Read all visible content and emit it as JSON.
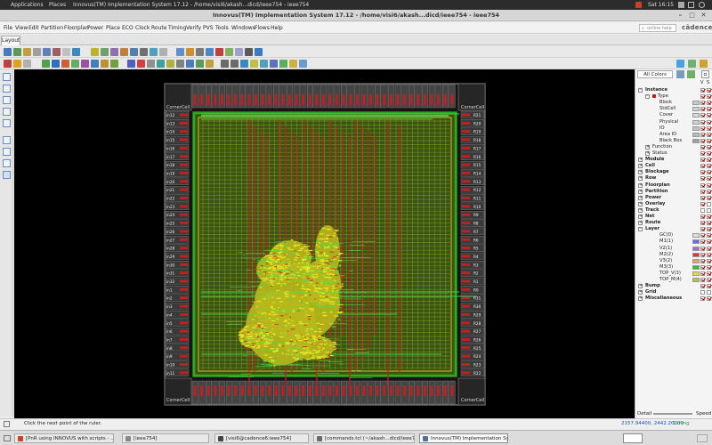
{
  "system_bar": {
    "applications": "Applications",
    "places": "Places",
    "window_title": "Innovus(TM) Implementation System 17.12 - /home/visi6/akash...dicd/ieee754 - ieee754",
    "clock": "Sat 16:15"
  },
  "title_bar": {
    "title": "Innovus(TM) Implementation System 17.12 - /home/visi6/akash...dicd/ieee754 - ieee754"
  },
  "menu": {
    "items": [
      "File",
      "View",
      "Edit",
      "Partition",
      "Floorplan",
      "Power",
      "Place",
      "ECO",
      "Clock",
      "Route",
      "Timing",
      "Verify",
      "PVS",
      "Tools",
      "Windows",
      "Flows",
      "Help"
    ],
    "search_placeholder": "online help",
    "brand": "cādence"
  },
  "tabs": {
    "layout": "Layout"
  },
  "canvas": {
    "corner_cell": "CornerCell",
    "pin_left_labels": [
      "in12",
      "in13",
      "in14",
      "in15",
      "in16",
      "in17",
      "in18",
      "in19",
      "in20",
      "in21",
      "in22",
      "in23",
      "in24",
      "in25",
      "in26",
      "in27",
      "in28",
      "in29",
      "in30",
      "in31",
      "in32",
      "in1",
      "in2",
      "in3",
      "in4",
      "in5",
      "in6",
      "in7",
      "in8",
      "in9",
      "in10",
      "in11"
    ],
    "pin_right_labels": [
      "R21",
      "R20",
      "R19",
      "R18",
      "R17",
      "R16",
      "R15",
      "R14",
      "R13",
      "R12",
      "R11",
      "R10",
      "R9",
      "R8",
      "R7",
      "R6",
      "R5",
      "R4",
      "R3",
      "R2",
      "R1",
      "R0",
      "R31",
      "R30",
      "R29",
      "R28",
      "R27",
      "R26",
      "R25",
      "R24",
      "R23",
      "R22"
    ]
  },
  "right_panel": {
    "dropdown": "All Colors",
    "col_v": "V",
    "col_s": "S",
    "tree": [
      {
        "label": "Instance",
        "level": 0,
        "bold": true,
        "exp": "-",
        "v": true,
        "s": true,
        "swatch": ""
      },
      {
        "label": "Type",
        "level": 1,
        "bold": false,
        "exp": "-",
        "v": true,
        "s": true,
        "swatch": "",
        "marker": "#d01010"
      },
      {
        "label": "Block",
        "level": 2,
        "bold": false,
        "exp": "",
        "v": true,
        "s": true,
        "swatch": "#c8c8c8"
      },
      {
        "label": "StdCell",
        "level": 2,
        "bold": false,
        "exp": "",
        "v": true,
        "s": true,
        "swatch": "#d0d0d0"
      },
      {
        "label": "Cover",
        "level": 2,
        "bold": false,
        "exp": "",
        "v": true,
        "s": true,
        "swatch": "#d8d8d8"
      },
      {
        "label": "Physical",
        "level": 2,
        "bold": false,
        "exp": "",
        "v": true,
        "s": true,
        "swatch": "#d0d0d0"
      },
      {
        "label": "IO",
        "level": 2,
        "bold": false,
        "exp": "",
        "v": true,
        "s": true,
        "swatch": "#c0c0c0"
      },
      {
        "label": "Area IO",
        "level": 2,
        "bold": false,
        "exp": "",
        "v": true,
        "s": true,
        "swatch": "#b8b8b8"
      },
      {
        "label": "Black Box",
        "level": 2,
        "bold": false,
        "exp": "",
        "v": true,
        "s": true,
        "swatch": "#a0a0a0"
      },
      {
        "label": "Function",
        "level": 1,
        "bold": false,
        "exp": "+",
        "v": true,
        "s": true,
        "swatch": ""
      },
      {
        "label": "Status",
        "level": 1,
        "bold": false,
        "exp": "+",
        "v": true,
        "s": true,
        "swatch": ""
      },
      {
        "label": "Module",
        "level": 0,
        "bold": true,
        "exp": "+",
        "v": true,
        "s": true,
        "swatch": ""
      },
      {
        "label": "Cell",
        "level": 0,
        "bold": true,
        "exp": "+",
        "v": true,
        "s": true,
        "swatch": ""
      },
      {
        "label": "Blockage",
        "level": 0,
        "bold": true,
        "exp": "+",
        "v": true,
        "s": true,
        "swatch": ""
      },
      {
        "label": "Row",
        "level": 0,
        "bold": true,
        "exp": "+",
        "v": true,
        "s": true,
        "swatch": ""
      },
      {
        "label": "Floorplan",
        "level": 0,
        "bold": true,
        "exp": "+",
        "v": true,
        "s": true,
        "swatch": ""
      },
      {
        "label": "Partition",
        "level": 0,
        "bold": true,
        "exp": "+",
        "v": true,
        "s": true,
        "swatch": ""
      },
      {
        "label": "Power",
        "level": 0,
        "bold": true,
        "exp": "+",
        "v": true,
        "s": true,
        "swatch": ""
      },
      {
        "label": "Overlay",
        "level": 0,
        "bold": true,
        "exp": "+",
        "v": true,
        "s": false,
        "swatch": ""
      },
      {
        "label": "Track",
        "level": 0,
        "bold": true,
        "exp": "+",
        "v": false,
        "s": false,
        "swatch": ""
      },
      {
        "label": "Net",
        "level": 0,
        "bold": true,
        "exp": "+",
        "v": true,
        "s": true,
        "swatch": ""
      },
      {
        "label": "Route",
        "level": 0,
        "bold": true,
        "exp": "+",
        "v": true,
        "s": true,
        "swatch": ""
      },
      {
        "label": "Layer",
        "level": 0,
        "bold": true,
        "exp": "-",
        "v": true,
        "s": true,
        "swatch": ""
      },
      {
        "label": "GC(0)",
        "level": 2,
        "bold": false,
        "exp": "",
        "v": true,
        "s": true,
        "swatch": "#e0e0e0"
      },
      {
        "label": "M1(1)",
        "level": 2,
        "bold": false,
        "exp": "",
        "v": true,
        "s": true,
        "swatch": "#6a6af0"
      },
      {
        "label": "V2(1)",
        "level": 2,
        "bold": false,
        "exp": "",
        "v": true,
        "s": true,
        "swatch": "#c060c0"
      },
      {
        "label": "M2(2)",
        "level": 2,
        "bold": false,
        "exp": "",
        "v": true,
        "s": true,
        "swatch": "#e03030"
      },
      {
        "label": "V3(2)",
        "level": 2,
        "bold": false,
        "exp": "",
        "v": true,
        "s": true,
        "swatch": "#f0a060"
      },
      {
        "label": "M3(3)",
        "level": 2,
        "bold": false,
        "exp": "",
        "v": true,
        "s": true,
        "swatch": "#30c030"
      },
      {
        "label": "TOP_V(3)",
        "level": 2,
        "bold": false,
        "exp": "",
        "v": true,
        "s": true,
        "swatch": "#e0e030"
      },
      {
        "label": "TOP_M(4)",
        "level": 2,
        "bold": false,
        "exp": "",
        "v": true,
        "s": true,
        "swatch": "#c0c040"
      },
      {
        "label": "Bump",
        "level": 0,
        "bold": true,
        "exp": "+",
        "v": true,
        "s": true,
        "swatch": ""
      },
      {
        "label": "Grid",
        "level": 0,
        "bold": true,
        "exp": "+",
        "v": false,
        "s": false,
        "swatch": ""
      },
      {
        "label": "Miscellaneous",
        "level": 0,
        "bold": true,
        "exp": "+",
        "v": true,
        "s": true,
        "swatch": ""
      }
    ],
    "footer_detail": "Detail",
    "footer_speed": "Speed"
  },
  "status_bar": {
    "message": "Click the next point of the ruler.",
    "coords": "2157.94400, 2442.20200",
    "timing": "Timing Analyzed"
  },
  "taskbar": {
    "items": [
      {
        "label": "[PnR using INNOVUS with scripts - ...",
        "color": "#d04020",
        "active": false
      },
      {
        "label": "[ieee754]",
        "color": "#888888",
        "active": false
      },
      {
        "label": "[visi6@cadence6:ieee754]",
        "color": "#444444",
        "active": false
      },
      {
        "label": "[commands.tcl (~/akash...dicd/ieee75...",
        "color": "#6a6a6a",
        "active": false
      },
      {
        "label": "Innovus(TM) Implementation Syste...",
        "color": "#5070a0",
        "active": true
      }
    ]
  },
  "colors": {
    "core_green": "#24b024",
    "route_red": "#c02020",
    "cell_yellow": "#e8e820",
    "io_gray": "#7c7c7c",
    "status_green": "#2e9a2e",
    "status_blue": "#1050d0"
  }
}
